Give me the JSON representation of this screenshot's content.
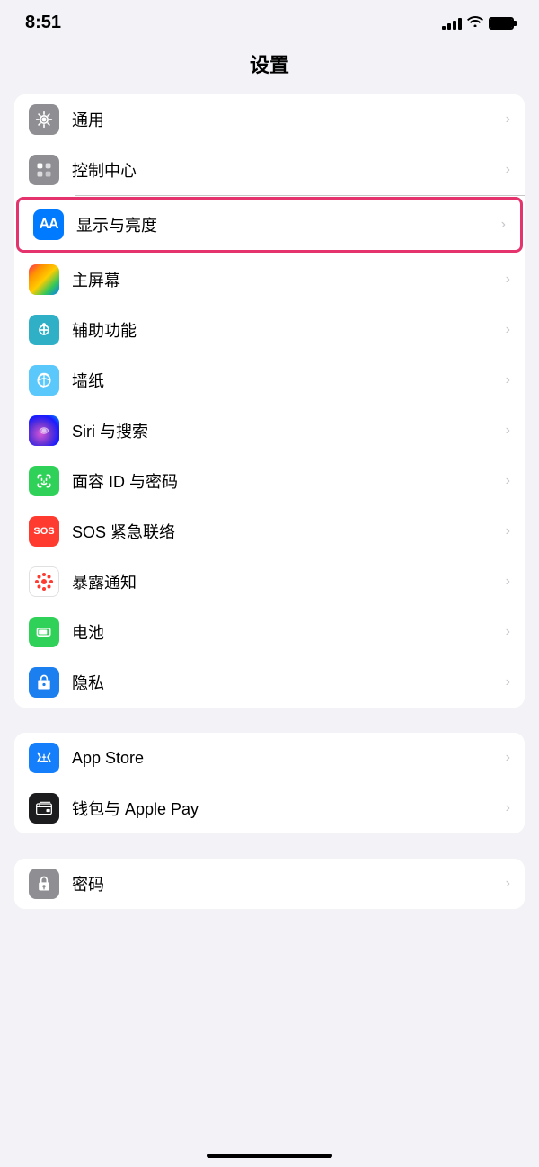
{
  "statusBar": {
    "time": "8:51",
    "battery": "full"
  },
  "pageTitle": "设置",
  "groups": [
    {
      "id": "group1",
      "items": [
        {
          "id": "tongyong",
          "label": "通用",
          "iconType": "gear",
          "iconBg": "gray",
          "highlighted": false
        },
        {
          "id": "kongzhizhongxin",
          "label": "控制中心",
          "iconType": "toggle",
          "iconBg": "gray",
          "highlighted": false
        },
        {
          "id": "xianshi",
          "label": "显示与亮度",
          "iconType": "aa",
          "iconBg": "blue",
          "highlighted": true
        },
        {
          "id": "zhupingmu",
          "label": "主屏幕",
          "iconType": "colorful",
          "iconBg": "colorful",
          "highlighted": false
        },
        {
          "id": "fuzhu",
          "label": "辅助功能",
          "iconType": "accessibility",
          "iconBg": "teal",
          "highlighted": false
        },
        {
          "id": "qiangzhi",
          "label": "墙纸",
          "iconType": "flower",
          "iconBg": "lightblue",
          "highlighted": false
        },
        {
          "id": "siri",
          "label": "Siri 与搜索",
          "iconType": "siri",
          "iconBg": "siri",
          "highlighted": false
        },
        {
          "id": "mianrong",
          "label": "面容 ID 与密码",
          "iconType": "faceid",
          "iconBg": "green",
          "highlighted": false
        },
        {
          "id": "sos",
          "label": "SOS 紧急联络",
          "iconType": "sos",
          "iconBg": "red",
          "highlighted": false
        },
        {
          "id": "baolu",
          "label": "暴露通知",
          "iconType": "exposure",
          "iconBg": "exposure",
          "highlighted": false
        },
        {
          "id": "dianchi",
          "label": "电池",
          "iconType": "battery",
          "iconBg": "battery",
          "highlighted": false
        },
        {
          "id": "yinsi",
          "label": "隐私",
          "iconType": "privacy",
          "iconBg": "privacy",
          "highlighted": false
        }
      ]
    },
    {
      "id": "group2",
      "items": [
        {
          "id": "appstore",
          "label": "App Store",
          "iconType": "appstore",
          "iconBg": "appstore",
          "highlighted": false
        },
        {
          "id": "wallet",
          "label": "钱包与 Apple Pay",
          "iconType": "wallet",
          "iconBg": "wallet",
          "highlighted": false
        }
      ]
    },
    {
      "id": "group3",
      "items": [
        {
          "id": "mima",
          "label": "密码",
          "iconType": "password",
          "iconBg": "password",
          "highlighted": false
        }
      ]
    }
  ]
}
